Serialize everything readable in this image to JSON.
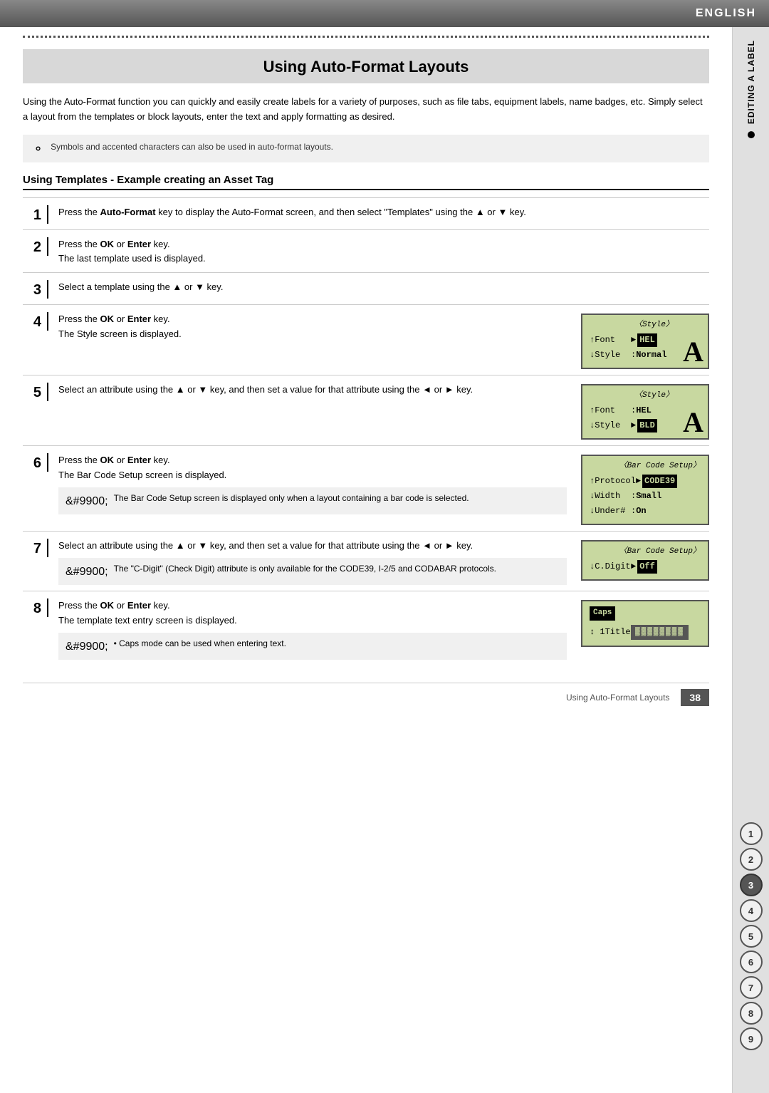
{
  "header": {
    "language": "ENGLISH"
  },
  "page": {
    "title": "Using Auto-Format Layouts",
    "intro": "Using the Auto-Format function you can quickly and easily create labels for a variety of purposes, such as file tabs, equipment labels, name badges, etc. Simply select a layout from the templates or block layouts, enter the text and apply formatting as desired.",
    "note": "Symbols and accented characters can also be used in auto-format layouts.",
    "section_heading": "Using Templates - Example creating an Asset Tag"
  },
  "steps": [
    {
      "num": "1",
      "text_parts": [
        {
          "type": "text",
          "content": "Press the "
        },
        {
          "type": "bold",
          "content": "Auto-Format"
        },
        {
          "type": "text",
          "content": " key to display the Auto-Format screen, and then select \"Templates\" using the ▲ or ▼ key."
        }
      ],
      "has_screen": false
    },
    {
      "num": "2",
      "line1_bold": "OK",
      "line1_text": " or ",
      "line1_bold2": "Enter",
      "line1_suffix": " key.",
      "line1_prefix": "Press the ",
      "line2": "The last template used is displayed.",
      "has_screen": false
    },
    {
      "num": "3",
      "text": "Select a template using the ▲ or ▼ key.",
      "has_screen": false
    },
    {
      "num": "4",
      "line1_prefix": "Press the ",
      "line1_bold": "OK",
      "line1_text": " or ",
      "line1_bold2": "Enter",
      "line1_suffix": " key.",
      "line2": "The Style screen is displayed.",
      "has_screen": true,
      "screen": {
        "title": "〈Style〉",
        "rows": [
          {
            "label": "↑Font",
            "arrow": "►",
            "value": "HEL",
            "selected": true
          },
          {
            "label": "↓Style",
            "colon": ":",
            "value": "Normal"
          }
        ],
        "big_letter": "A"
      }
    },
    {
      "num": "5",
      "text": "Select an attribute using the ▲ or ▼ key, and then set a value for that attribute using the ◄ or ► key.",
      "has_screen": true,
      "screen": {
        "title": "〈Style〉",
        "rows": [
          {
            "label": "↑Font",
            "colon": ":",
            "value": "HEL",
            "selected": false
          },
          {
            "label": "↓Style",
            "arrow": "►",
            "value": "BLD",
            "selected": true
          }
        ],
        "big_letter": "A"
      }
    },
    {
      "num": "6",
      "line1_prefix": "Press the ",
      "line1_bold": "OK",
      "line1_text": " or ",
      "line1_bold2": "Enter",
      "line1_suffix": " key.",
      "line2": "The Bar Code Setup screen is displayed.",
      "note": "The Bar Code Setup screen is displayed only when a layout containing a bar code is selected.",
      "has_screen": true,
      "screen": {
        "title": "〈Bar Code Setup〉",
        "rows": [
          {
            "label": "↑Protocol",
            "arrow": "►",
            "value": "CODE39",
            "selected": true
          },
          {
            "label": "↓Width",
            "colon": ":",
            "value": "Small",
            "selected": false
          },
          {
            "label": "↓Under#",
            "colon": ":",
            "value": "On",
            "selected": false
          }
        ],
        "big_letter": ""
      }
    },
    {
      "num": "7",
      "text": "Select an attribute using the ▲ or ▼ key, and then set a value for that attribute using the ◄ or ► key.",
      "note": "The \"C-Digit\" (Check Digit) attribute is only available for the CODE39, I-2/5 and CODABAR protocols.",
      "has_screen": true,
      "screen": {
        "title": "〈Bar Code Setup〉",
        "rows": [
          {
            "label": "↓C.Digit",
            "arrow": "►",
            "value": "Off",
            "selected": true
          }
        ],
        "big_letter": ""
      }
    },
    {
      "num": "8",
      "line1_prefix": "Press the ",
      "line1_bold": "OK",
      "line1_text": " or ",
      "line1_bold2": "Enter",
      "line1_suffix": " key.",
      "line2": "The template text entry screen is displayed.",
      "note": "• Caps mode can be used when entering text.",
      "has_screen": true,
      "screen": {
        "title": "caps",
        "rows": [
          {
            "label": "↕ 1Title",
            "value": "▓▓▓▓▓▓▓▓",
            "selected": false,
            "is_entry": true
          }
        ],
        "big_letter": ""
      }
    }
  ],
  "sidebar": {
    "label": "EDITING A LABEL",
    "numbers": [
      "1",
      "2",
      "3",
      "4",
      "5",
      "6",
      "7",
      "8",
      "9"
    ],
    "active": "3"
  },
  "footer": {
    "text": "Using Auto-Format Layouts",
    "page": "38"
  }
}
